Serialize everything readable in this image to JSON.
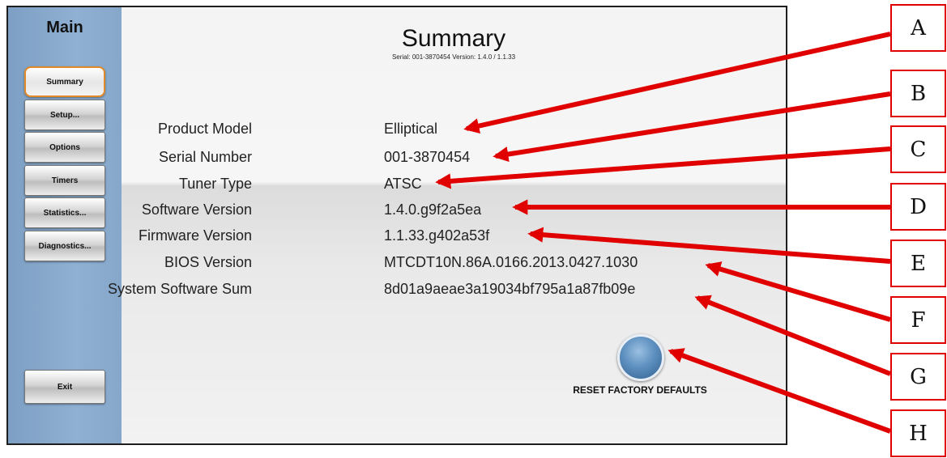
{
  "sidebar": {
    "title": "Main",
    "items": [
      {
        "label": "Summary",
        "active": true
      },
      {
        "label": "Setup..."
      },
      {
        "label": "Options"
      },
      {
        "label": "Timers"
      },
      {
        "label": "Statistics..."
      },
      {
        "label": "Diagnostics..."
      }
    ],
    "exit_label": "Exit"
  },
  "main": {
    "title": "Summary",
    "subtitle": "Serial: 001-3870454   Version: 1.4.0 / 1.1.33",
    "rows": [
      {
        "label": "Product Model",
        "value": "Elliptical"
      },
      {
        "label": "Serial Number",
        "value": "001-3870454"
      },
      {
        "label": "Tuner Type",
        "value": "ATSC"
      },
      {
        "label": "Software Version",
        "value": "1.4.0.g9f2a5ea"
      },
      {
        "label": "Firmware Version",
        "value": "1.1.33.g402a53f"
      },
      {
        "label": "BIOS Version",
        "value": "MTCDT10N.86A.0166.2013.0427.1030"
      },
      {
        "label": "System Software Sum",
        "value": "8d01a9aeae3a19034bf795a1a87fb09e"
      }
    ],
    "reset_label": "RESET FACTORY DEFAULTS"
  },
  "callouts": [
    "A",
    "B",
    "C",
    "D",
    "E",
    "F",
    "G",
    "H"
  ],
  "colors": {
    "accent_orange": "#e28a2a",
    "sidebar_blue": "#8fb0d2",
    "callout_red": "#e00000"
  }
}
